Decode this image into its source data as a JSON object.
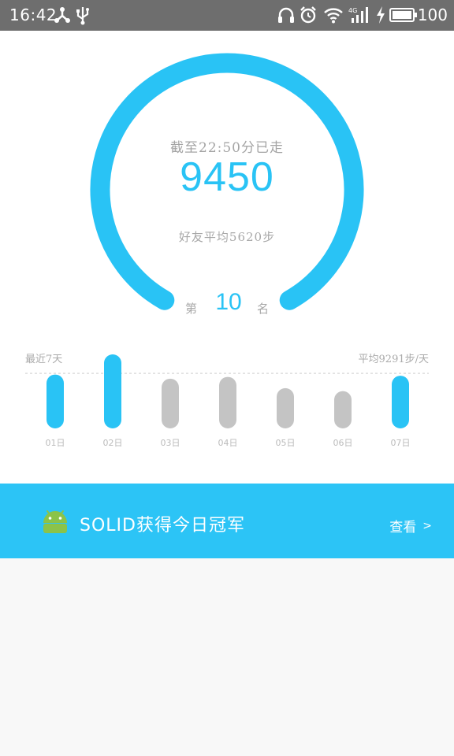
{
  "status_bar": {
    "time": "16:42",
    "battery": "100",
    "icons": [
      "share-icon",
      "usb-icon",
      "headphones-icon",
      "alarm-icon",
      "wifi-icon",
      "signal-4g-icon",
      "charging-icon",
      "battery-icon"
    ]
  },
  "summary": {
    "until_text": "截至22:50分已走",
    "steps": "9450",
    "friends_average": "好友平均5620步",
    "rank_prefix": "第",
    "rank": "10",
    "rank_suffix": "名",
    "ring_color": "#29c3f5"
  },
  "chart_data": {
    "type": "bar",
    "left_label": "最近7天",
    "right_label": "平均9291步/天",
    "categories": [
      "01日",
      "02日",
      "03日",
      "04日",
      "05日",
      "06日",
      "07日"
    ],
    "values": [
      9100,
      12500,
      8400,
      8700,
      6800,
      6300,
      8900
    ],
    "average": 9291,
    "highlight": [
      true,
      true,
      false,
      false,
      false,
      false,
      true
    ],
    "colors": {
      "above": "#29c3f5",
      "below": "#c4c4c4"
    }
  },
  "banner": {
    "text": "SOLID获得今日冠军",
    "link": "查看",
    "icon": "android-icon",
    "background": "#2cc4f6"
  }
}
